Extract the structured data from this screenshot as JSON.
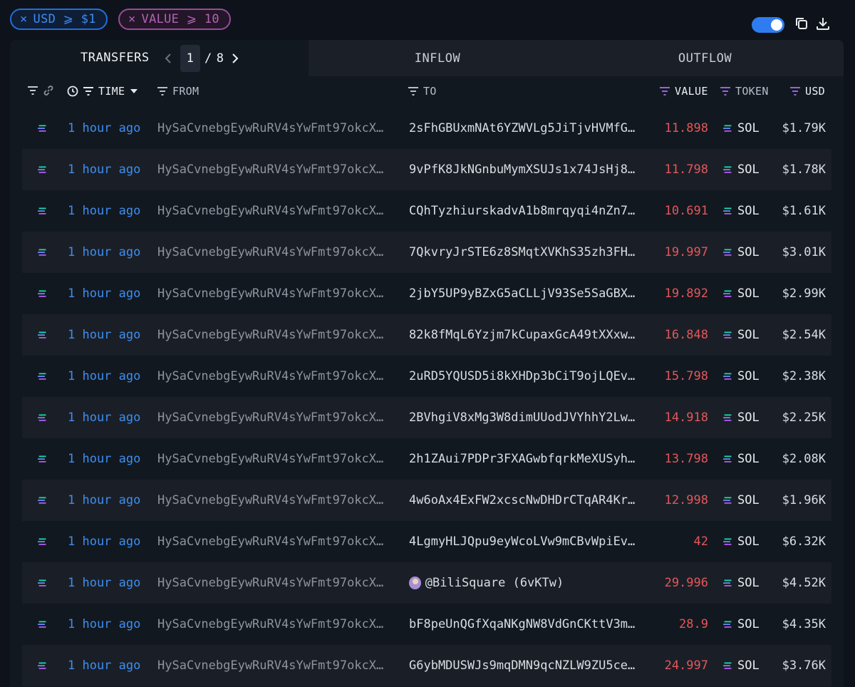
{
  "filters": {
    "usd": {
      "label": "USD ⩾ $1",
      "color": "#3c8cf7"
    },
    "value": {
      "label": "VALUE ⩾ 10",
      "color": "#b263b5"
    }
  },
  "toggle": {
    "on": true
  },
  "tabs": {
    "transfers": "TRANSFERS",
    "inflow": "INFLOW",
    "outflow": "OUTFLOW"
  },
  "pager": {
    "current": "1",
    "separator": "/",
    "total": "8"
  },
  "columns": {
    "time": "TIME",
    "from": "FROM",
    "to": "TO",
    "value": "VALUE",
    "token": "TOKEN",
    "usd": "USD"
  },
  "rows": [
    {
      "time": "1 hour ago",
      "from": "HySaCvnebgEywRuRV4sYwFmt97okcX…",
      "to": "2sFhGBUxmNAt6YZWVLg5JiTjvHVMfG…",
      "value": "11.898",
      "token": "SOL",
      "usd": "$1.79K"
    },
    {
      "time": "1 hour ago",
      "from": "HySaCvnebgEywRuRV4sYwFmt97okcX…",
      "to": "9vPfK8JkNGnbuMymXSUJs1x74JsHj8…",
      "value": "11.798",
      "token": "SOL",
      "usd": "$1.78K"
    },
    {
      "time": "1 hour ago",
      "from": "HySaCvnebgEywRuRV4sYwFmt97okcX…",
      "to": "CQhTyzhiurskadvA1b8mrqyqi4nZn7…",
      "value": "10.691",
      "token": "SOL",
      "usd": "$1.61K"
    },
    {
      "time": "1 hour ago",
      "from": "HySaCvnebgEywRuRV4sYwFmt97okcX…",
      "to": "7QkvryJrSTE6z8SMqtXVKhS35zh3FH…",
      "value": "19.997",
      "token": "SOL",
      "usd": "$3.01K"
    },
    {
      "time": "1 hour ago",
      "from": "HySaCvnebgEywRuRV4sYwFmt97okcX…",
      "to": "2jbY5UP9yBZxG5aCLLjV93Se5SaGBX…",
      "value": "19.892",
      "token": "SOL",
      "usd": "$2.99K"
    },
    {
      "time": "1 hour ago",
      "from": "HySaCvnebgEywRuRV4sYwFmt97okcX…",
      "to": "82k8fMqL6Yzjm7kCupaxGcA49tXXxw…",
      "value": "16.848",
      "token": "SOL",
      "usd": "$2.54K"
    },
    {
      "time": "1 hour ago",
      "from": "HySaCvnebgEywRuRV4sYwFmt97okcX…",
      "to": "2uRD5YQUSD5i8kXHDp3bCiT9ojLQEv…",
      "value": "15.798",
      "token": "SOL",
      "usd": "$2.38K"
    },
    {
      "time": "1 hour ago",
      "from": "HySaCvnebgEywRuRV4sYwFmt97okcX…",
      "to": "2BVhgiV8xMg3W8dimUUodJVYhhY2Lw…",
      "value": "14.918",
      "token": "SOL",
      "usd": "$2.25K"
    },
    {
      "time": "1 hour ago",
      "from": "HySaCvnebgEywRuRV4sYwFmt97okcX…",
      "to": "2h1ZAui7PDPr3FXAGwbfqrkMeXUSyh…",
      "value": "13.798",
      "token": "SOL",
      "usd": "$2.08K"
    },
    {
      "time": "1 hour ago",
      "from": "HySaCvnebgEywRuRV4sYwFmt97okcX…",
      "to": "4w6oAx4ExFW2xcscNwDHDrCTqAR4Kr…",
      "value": "12.998",
      "token": "SOL",
      "usd": "$1.96K"
    },
    {
      "time": "1 hour ago",
      "from": "HySaCvnebgEywRuRV4sYwFmt97okcX…",
      "to": "4LgmyHLJQpu9eyWcoLVw9mCBvWpiEv…",
      "value": "42",
      "token": "SOL",
      "usd": "$6.32K"
    },
    {
      "time": "1 hour ago",
      "from": "HySaCvnebgEywRuRV4sYwFmt97okcX…",
      "to": "@BiliSquare (6vKTw)",
      "to_entity": true,
      "value": "29.996",
      "token": "SOL",
      "usd": "$4.52K"
    },
    {
      "time": "1 hour ago",
      "from": "HySaCvnebgEywRuRV4sYwFmt97okcX…",
      "to": "bF8peUnQGfXqaNKgNW8VdGnCKttV3m…",
      "value": "28.9",
      "token": "SOL",
      "usd": "$4.35K"
    },
    {
      "time": "1 hour ago",
      "from": "HySaCvnebgEywRuRV4sYwFmt97okcX…",
      "to": "G6ybMDUSWJs9mqDMN9qcNZLW9ZU5ce…",
      "value": "24.997",
      "token": "SOL",
      "usd": "$3.76K"
    }
  ],
  "colors": {
    "time": "#3d8ef0",
    "value": "#e4575a",
    "accent": "#2f7cf0"
  }
}
